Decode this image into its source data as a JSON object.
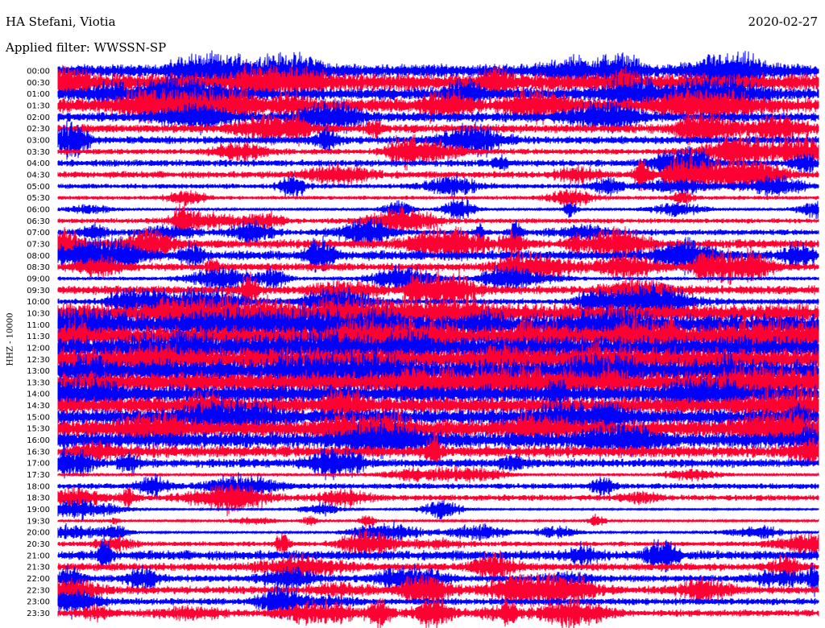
{
  "header": {
    "station": "HA Stefani, Viotia",
    "filter": "Applied filter: WWSSN-SP",
    "date": "2020-02-27",
    "channel": "HHZ - 10000"
  },
  "colors": {
    "trace_a": "#0000ff",
    "trace_b": "#ff0033",
    "text": "#000000",
    "background": "#ffffff"
  },
  "chart_data": {
    "type": "line",
    "title": "HA Stefani, Viotia",
    "subtitle": "Applied filter: WWSSN-SP",
    "ylabel": "HHZ - 10000",
    "row_labels": [
      "00:00",
      "00:30",
      "01:00",
      "01:30",
      "02:00",
      "02:30",
      "03:00",
      "03:30",
      "04:00",
      "04:30",
      "05:00",
      "05:30",
      "06:00",
      "06:30",
      "07:00",
      "07:30",
      "08:00",
      "08:30",
      "09:00",
      "09:30",
      "10:00",
      "10:30",
      "11:00",
      "11:30",
      "12:00",
      "12:30",
      "13:00",
      "13:30",
      "14:00",
      "14:30",
      "15:00",
      "15:30",
      "16:00",
      "16:30",
      "17:00",
      "17:30",
      "18:00",
      "18:30",
      "19:00",
      "19:30",
      "20:00",
      "20:30",
      "21:00",
      "21:30",
      "22:00",
      "22:30",
      "23:00",
      "23:30"
    ],
    "row_activity": [
      0.7,
      0.95,
      0.65,
      0.75,
      0.5,
      0.45,
      0.4,
      0.3,
      0.35,
      0.35,
      0.25,
      0.2,
      0.12,
      0.25,
      0.3,
      0.45,
      0.5,
      0.4,
      0.2,
      0.45,
      0.3,
      1.0,
      1.1,
      1.1,
      1.2,
      1.25,
      1.2,
      1.15,
      0.95,
      0.9,
      0.85,
      0.95,
      0.85,
      0.6,
      0.45,
      0.15,
      0.3,
      0.3,
      0.08,
      0.1,
      0.1,
      0.25,
      0.5,
      0.4,
      0.35,
      0.4,
      0.35,
      0.35
    ],
    "trace_colors_alternate": [
      "blue",
      "red"
    ],
    "grid": false
  }
}
